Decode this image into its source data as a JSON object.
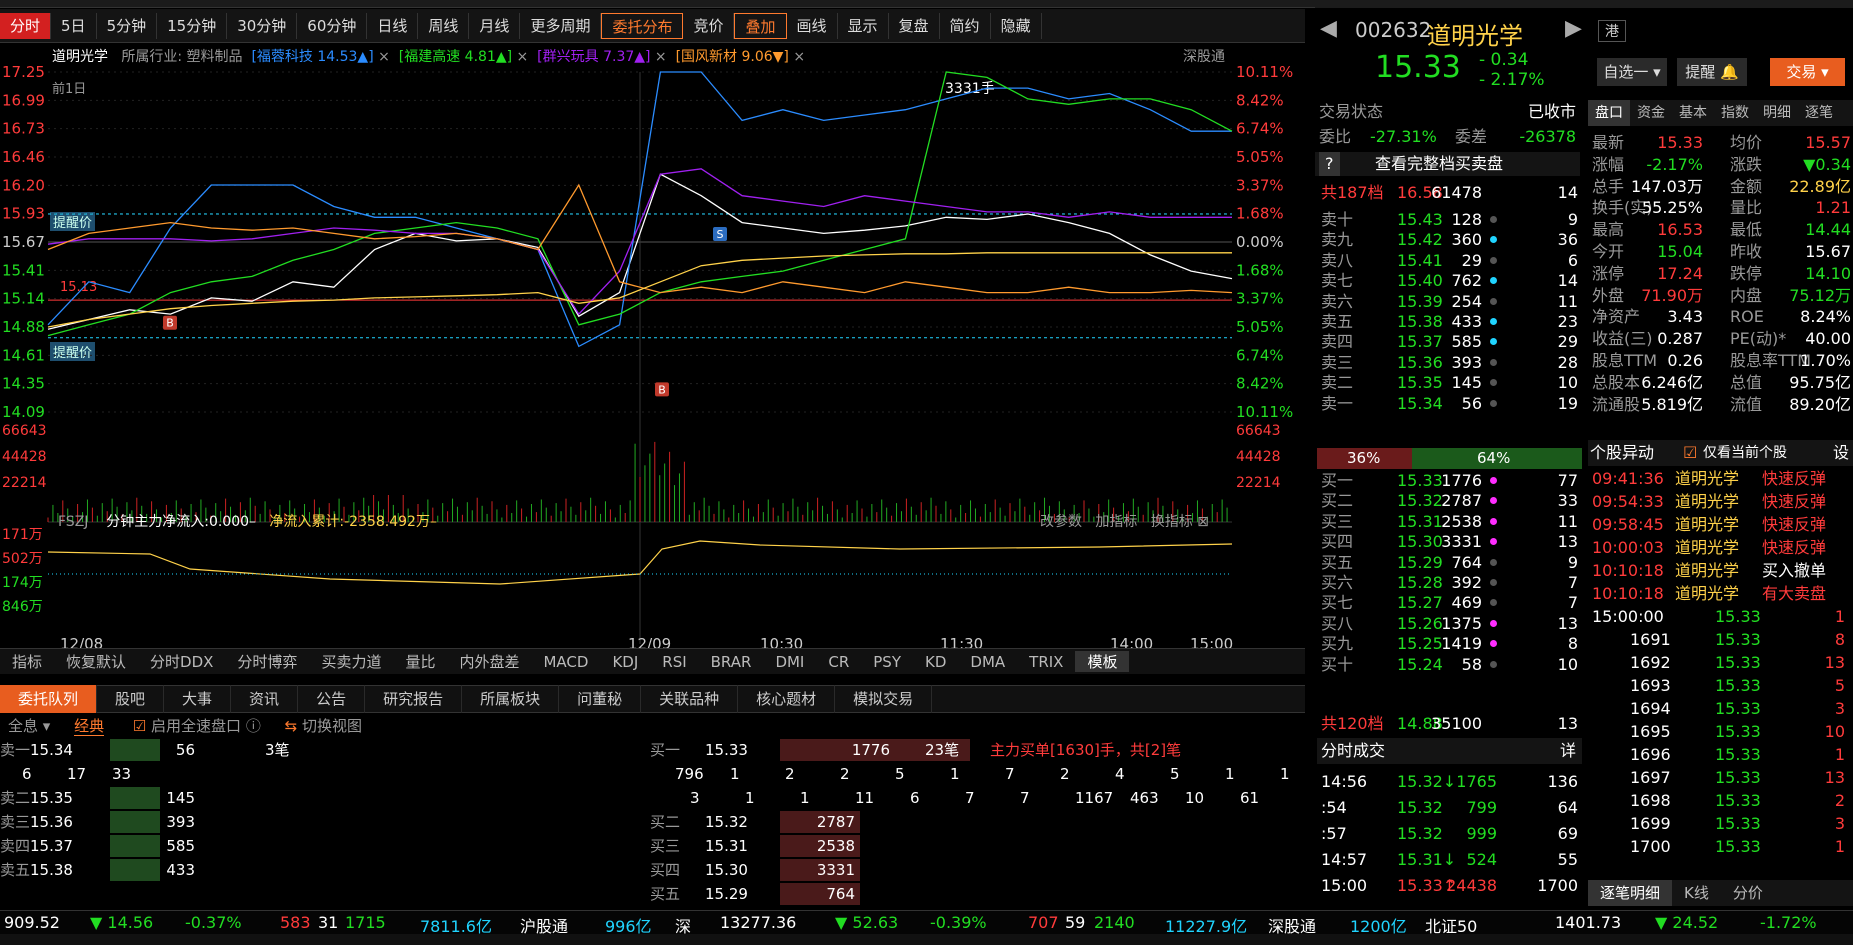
{
  "toolbar": {
    "items": [
      "分时",
      "5日",
      "5分钟",
      "15分钟",
      "30分钟",
      "60分钟",
      "日线",
      "周线",
      "月线",
      "更多周期",
      "委托分布",
      "竞价",
      "叠加",
      "画线",
      "显示",
      "复盘",
      "简约",
      "隐藏"
    ]
  },
  "chart_header": {
    "stock": "道明光学",
    "industry": "所属行业: 塑料制品",
    "cmp1": "[福蓉科技 14.53▲]",
    "cmp2": "[福建高速 4.81▲]",
    "cmp3": "[群兴玩具 7.37▲]",
    "cmp4": "[国风新材 9.06▼]",
    "market": "深股通",
    "prev_day": "前1日",
    "vol_note": "3331手",
    "remind_hi": "提醒价",
    "remind_lo": "提醒价",
    "ref_price": "15.13"
  },
  "chart_data": {
    "type": "line",
    "title": "道明光学 分时",
    "y_left": [
      "17.25",
      "16.99",
      "16.73",
      "16.46",
      "16.20",
      "15.93",
      "15.67",
      "15.41",
      "15.14",
      "14.88",
      "14.61",
      "14.35",
      "14.09"
    ],
    "y_right": [
      "10.11%",
      "8.42%",
      "6.74%",
      "5.05%",
      "3.37%",
      "1.68%",
      "0.00%",
      "1.68%",
      "3.37%",
      "5.05%",
      "6.74%",
      "8.42%",
      "10.11%"
    ],
    "x_labels": [
      "12/08",
      "12/09",
      "10:30",
      "11:30",
      "14:00",
      "15:00"
    ],
    "vol_left": [
      "66643",
      "44428",
      "22214"
    ],
    "vol_right": [
      "66643",
      "44428",
      "22214"
    ],
    "fund_left": [
      "171万",
      "502万",
      "174万",
      "846万"
    ],
    "series": [
      {
        "name": "道明光学",
        "color": "#ffffff",
        "values": [
          14.86,
          14.95,
          15.04,
          15.0,
          15.15,
          15.12,
          15.3,
          15.25,
          15.6,
          15.75,
          15.68,
          15.7,
          15.62,
          14.98,
          15.2,
          16.3,
          16.1,
          15.85,
          15.8,
          15.75,
          15.78,
          15.82,
          15.9,
          15.88,
          15.93,
          15.85,
          15.75,
          15.55,
          15.4,
          15.33
        ]
      },
      {
        "name": "福蓉科技",
        "color": "#2b8cff",
        "values": [
          14.9,
          15.3,
          15.2,
          15.8,
          16.2,
          16.2,
          16.2,
          16.0,
          15.9,
          15.9,
          15.8,
          15.7,
          15.6,
          14.7,
          14.9,
          17.25,
          17.25,
          16.8,
          16.9,
          16.8,
          16.85,
          16.9,
          17.0,
          17.1,
          17.1,
          17.0,
          17.05,
          16.9,
          16.7,
          16.7
        ]
      },
      {
        "name": "福建高速",
        "color": "#22dd22",
        "values": [
          14.8,
          14.9,
          15.0,
          15.2,
          15.3,
          15.35,
          15.5,
          15.6,
          15.75,
          15.8,
          15.85,
          15.8,
          15.7,
          14.9,
          15.0,
          15.2,
          15.3,
          15.35,
          15.4,
          15.5,
          15.6,
          15.7,
          17.25,
          17.2,
          17.0,
          16.95,
          17.0,
          17.0,
          16.9,
          16.7
        ]
      },
      {
        "name": "群兴玩具",
        "color": "#a020f0",
        "values": [
          15.65,
          15.7,
          15.7,
          15.7,
          15.68,
          15.7,
          15.75,
          15.8,
          15.78,
          15.75,
          15.75,
          15.7,
          15.6,
          15.0,
          15.4,
          16.3,
          16.35,
          16.1,
          16.05,
          16.0,
          16.1,
          16.05,
          16.0,
          15.95,
          15.95,
          15.9,
          15.95,
          15.9,
          15.9,
          15.9
        ]
      },
      {
        "name": "国风新材",
        "color": "#ff9a2e",
        "values": [
          15.6,
          15.75,
          15.8,
          15.85,
          15.8,
          15.78,
          15.8,
          15.75,
          15.7,
          15.72,
          15.75,
          15.7,
          15.6,
          16.2,
          15.3,
          15.2,
          15.25,
          15.2,
          15.3,
          15.25,
          15.2,
          15.3,
          15.25,
          15.2,
          15.2,
          15.25,
          15.2,
          15.2,
          15.22,
          15.2
        ]
      },
      {
        "name": "均价",
        "color": "#ffd24a",
        "values": [
          14.88,
          14.95,
          15.0,
          15.05,
          15.08,
          15.1,
          15.12,
          15.13,
          15.15,
          15.16,
          15.17,
          15.18,
          15.2,
          15.1,
          15.15,
          15.3,
          15.45,
          15.5,
          15.52,
          15.54,
          15.55,
          15.56,
          15.56,
          15.57,
          15.57,
          15.57,
          15.57,
          15.57,
          15.57,
          15.57
        ]
      }
    ]
  },
  "indicator": {
    "label": "FSZJ",
    "flow": "分钟主力净流入:0.000–",
    "cum": "净流入累计:-2358.492万–",
    "btns": [
      "改参数",
      "加指标",
      "换指标"
    ]
  },
  "ind_tabs": [
    "指标",
    "恢复默认",
    "分时DDX",
    "分时博弈",
    "买卖力道",
    "量比",
    "内外盘差",
    "MACD",
    "KDJ",
    "RSI",
    "BRAR",
    "DMI",
    "CR",
    "PSY",
    "KD",
    "DMA",
    "TRIX",
    "模板"
  ],
  "bottom_tabs": [
    "委托队列",
    "股吧",
    "大事",
    "资讯",
    "公告",
    "研究报告",
    "所属板块",
    "问董秘",
    "关联品种",
    "核心题材",
    "模拟交易"
  ],
  "queue": {
    "opt_all": "全息",
    "opt_classic": "经典",
    "opt_fast": "启用全速盘口",
    "opt_switch": "切换视图",
    "sell": [
      {
        "l": "卖一",
        "p": "15.34",
        "v": "56",
        "n": "3笔"
      },
      {
        "l": "卖二",
        "p": "15.35",
        "v": "145"
      },
      {
        "l": "卖三",
        "p": "15.36",
        "v": "393"
      },
      {
        "l": "卖四",
        "p": "15.37",
        "v": "585"
      },
      {
        "l": "卖五",
        "p": "15.38",
        "v": "433"
      }
    ],
    "sell_detail": [
      "6",
      "17",
      "33"
    ],
    "buy1": {
      "l": "买一",
      "p": "15.33",
      "v": "1776",
      "n": "23笔",
      "main": "主力买单[1630]手，共[2]笔"
    },
    "buy_detail1": [
      "796",
      "1",
      "2",
      "2",
      "5",
      "1",
      "7",
      "2",
      "4",
      "5",
      "1",
      "1"
    ],
    "buy_detail2": [
      "3",
      "1",
      "1",
      "11",
      "6",
      "7",
      "7",
      "1167",
      "463",
      "10",
      "61"
    ],
    "buys": [
      {
        "l": "买二",
        "p": "15.32",
        "v": "2787"
      },
      {
        "l": "买三",
        "p": "15.31",
        "v": "2538"
      },
      {
        "l": "买四",
        "p": "15.30",
        "v": "3331"
      },
      {
        "l": "买五",
        "p": "15.29",
        "v": "764"
      }
    ]
  },
  "right": {
    "code": "002632",
    "name": "道明光学",
    "price": "15.33",
    "chg": "- 0.34",
    "pct": "- 2.17%",
    "gang": "港",
    "btn_zx": "自选一",
    "btn_remind": "提醒",
    "btn_trade": "交易",
    "status_label": "交易状态",
    "status": "已收市",
    "wb_label": "委比",
    "wb": "-27.31%",
    "wc_label": "委差",
    "wc": "-26378",
    "full_ob": "查看完整档买卖盘",
    "top_total": {
      "l": "共187档",
      "p": "16.58",
      "v": "61478",
      "n": "14"
    },
    "asks": [
      {
        "l": "卖十",
        "p": "15.43",
        "v": "128",
        "n": "9",
        "c": "#555"
      },
      {
        "l": "卖九",
        "p": "15.42",
        "v": "360",
        "n": "36",
        "c": "#20d4ff"
      },
      {
        "l": "卖八",
        "p": "15.41",
        "v": "29",
        "n": "6",
        "c": "#555"
      },
      {
        "l": "卖七",
        "p": "15.40",
        "v": "762",
        "n": "14",
        "c": "#20d4ff"
      },
      {
        "l": "卖六",
        "p": "15.39",
        "v": "254",
        "n": "11",
        "c": "#555"
      },
      {
        "l": "卖五",
        "p": "15.38",
        "v": "433",
        "n": "23",
        "c": "#20d4ff"
      },
      {
        "l": "卖四",
        "p": "15.37",
        "v": "585",
        "n": "29",
        "c": "#20d4ff"
      },
      {
        "l": "卖三",
        "p": "15.36",
        "v": "393",
        "n": "28",
        "c": "#555"
      },
      {
        "l": "卖二",
        "p": "15.35",
        "v": "145",
        "n": "10",
        "c": "#555"
      },
      {
        "l": "卖一",
        "p": "15.34",
        "v": "56",
        "n": "19",
        "c": "#555"
      }
    ],
    "ratio_sell": "36%",
    "ratio_buy": "64%",
    "bids": [
      {
        "l": "买一",
        "p": "15.33",
        "v": "1776",
        "n": "77",
        "c": "#ff2dff"
      },
      {
        "l": "买二",
        "p": "15.32",
        "v": "2787",
        "n": "33",
        "c": "#ff2dff"
      },
      {
        "l": "买三",
        "p": "15.31",
        "v": "2538",
        "n": "11",
        "c": "#ff2dff"
      },
      {
        "l": "买四",
        "p": "15.30",
        "v": "3331",
        "n": "13",
        "c": "#ff2dff"
      },
      {
        "l": "买五",
        "p": "15.29",
        "v": "764",
        "n": "9",
        "c": "#555"
      },
      {
        "l": "买六",
        "p": "15.28",
        "v": "392",
        "n": "7",
        "c": "#555"
      },
      {
        "l": "买七",
        "p": "15.27",
        "v": "469",
        "n": "7",
        "c": "#555"
      },
      {
        "l": "买八",
        "p": "15.26",
        "v": "1375",
        "n": "13",
        "c": "#ff2dff"
      },
      {
        "l": "买九",
        "p": "15.25",
        "v": "1419",
        "n": "8",
        "c": "#ff2dff"
      },
      {
        "l": "买十",
        "p": "15.24",
        "v": "58",
        "n": "10",
        "c": "#555"
      }
    ],
    "bot_total": {
      "l": "共120档",
      "p": "14.88",
      "v": "35100",
      "n": "13"
    },
    "trades_title": "分时成交",
    "trades_btn": "详",
    "trades": [
      {
        "t": "14:56",
        "p": "15.32↓",
        "v": "1765",
        "n": "136",
        "c": "grn"
      },
      {
        "t": ":54",
        "p": "15.32",
        "v": "799",
        "n": "64",
        "c": "grn"
      },
      {
        "t": ":57",
        "p": "15.32",
        "v": "999",
        "n": "69",
        "c": "grn"
      },
      {
        "t": "14:57",
        "p": "15.31↓",
        "v": "524",
        "n": "55",
        "c": "grn"
      },
      {
        "t": "15:00",
        "p": "15.33↑",
        "v": "24438",
        "n": "1700",
        "c": "red"
      }
    ],
    "qtabs": [
      "盘口",
      "资金",
      "基本",
      "指数",
      "明细",
      "逐笔"
    ],
    "quote": [
      [
        "最新",
        "15.33",
        "red",
        "均价",
        "15.57",
        "red"
      ],
      [
        "涨幅",
        "-2.17%",
        "grn",
        "涨跌",
        "▼0.34",
        "grn"
      ],
      [
        "总手",
        "147.03万",
        "wht",
        "金额",
        "22.89亿",
        "yel"
      ],
      [
        "换手(实)",
        "55.25%",
        "wht",
        "量比",
        "1.21",
        "red"
      ],
      [
        "最高",
        "16.53",
        "red",
        "最低",
        "14.44",
        "grn"
      ],
      [
        "今开",
        "15.04",
        "grn",
        "昨收",
        "15.67",
        "wht"
      ],
      [
        "涨停",
        "17.24",
        "red",
        "跌停",
        "14.10",
        "grn"
      ],
      [
        "外盘",
        "71.90万",
        "red",
        "内盘",
        "75.12万",
        "grn"
      ],
      [
        "净资产",
        "3.43",
        "wht",
        "ROE",
        "8.24%",
        "wht"
      ],
      [
        "收益(三)",
        "0.287",
        "wht",
        "PE(动)*",
        "40.00",
        "wht"
      ],
      [
        "股息TTM",
        "0.26",
        "wht",
        "股息率TTM",
        "1.70%",
        "wht"
      ],
      [
        "总股本",
        "6.246亿",
        "wht",
        "总值",
        "95.75亿",
        "wht"
      ],
      [
        "流通股",
        "5.819亿",
        "wht",
        "流值",
        "89.20亿",
        "wht"
      ]
    ],
    "alert_title": "个股异动",
    "alert_only": "仅看当前个股",
    "alert_set": "设",
    "alerts": [
      [
        "09:41:36",
        "道明光学",
        "快速反弹"
      ],
      [
        "09:54:33",
        "道明光学",
        "快速反弹"
      ],
      [
        "09:58:45",
        "道明光学",
        "快速反弹"
      ],
      [
        "10:00:03",
        "道明光学",
        "快速反弹"
      ],
      [
        "10:10:18",
        "道明光学",
        "买入撤单"
      ],
      [
        "10:10:18",
        "道明光学",
        "有大卖盘"
      ]
    ],
    "ticks": [
      [
        "15:00:00",
        "15.33",
        "1"
      ],
      [
        "1691",
        "15.33",
        "8"
      ],
      [
        "1692",
        "15.33",
        "13"
      ],
      [
        "1693",
        "15.33",
        "5"
      ],
      [
        "1694",
        "15.33",
        "3"
      ],
      [
        "1695",
        "15.33",
        "10"
      ],
      [
        "1696",
        "15.33",
        "1"
      ],
      [
        "1697",
        "15.33",
        "13"
      ],
      [
        "1698",
        "15.33",
        "2"
      ],
      [
        "1699",
        "15.33",
        "3"
      ],
      [
        "1700",
        "15.33",
        "1"
      ]
    ],
    "tick_tabs": [
      "逐笔明细",
      "K线",
      "分价"
    ]
  },
  "ticker": {
    "a": "909.52",
    "b": "▼ 14.56",
    "c": "-0.37%",
    "d": "583",
    "e": "31",
    "f": "1715",
    "g": "7811.6亿",
    "h": "沪股通",
    "i": "996亿",
    "j": "深",
    "k": "13277.36",
    "l": "▼ 52.63",
    "m": "-0.39%",
    "n": "707",
    "o": "59",
    "p": "2140",
    "q": "11227.9亿",
    "r": "深股通",
    "s": "1200亿",
    "t": "北证50",
    "u": "1401.73",
    "v": "▼ 24.52",
    "w": "-1.72%"
  }
}
